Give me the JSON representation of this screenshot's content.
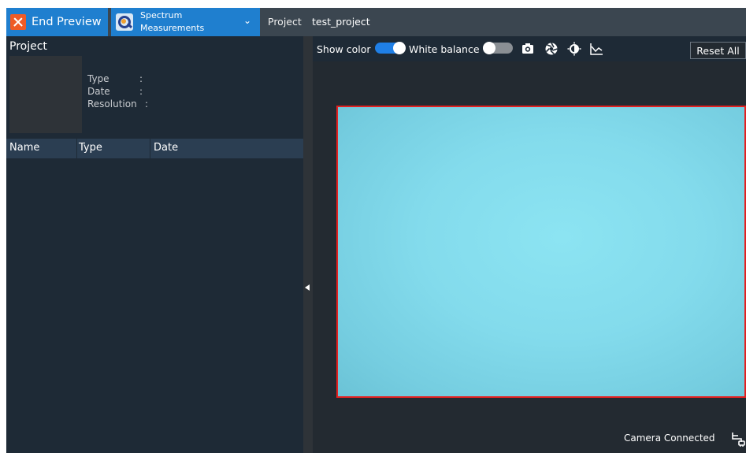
{
  "topbar": {
    "end_preview_label": "End Preview",
    "mode_line1": "Spectrum",
    "mode_line2": "Measurements",
    "project_label": "Project",
    "project_name": "test_project"
  },
  "left_panel": {
    "title": "Project",
    "meta": [
      {
        "label": "Type",
        "sep": ":",
        "value": ""
      },
      {
        "label": "Date",
        "sep": ":",
        "value": ""
      },
      {
        "label": "Resolution",
        "sep": ":",
        "value": ""
      }
    ],
    "columns": [
      "Name",
      "Type",
      "Date"
    ],
    "rows": []
  },
  "toolbar": {
    "show_color_label": "Show color",
    "show_color_on": true,
    "white_balance_label": "White balance",
    "white_balance_on": false,
    "icons": [
      "camera-icon",
      "aperture-icon",
      "contrast-icon",
      "chart-icon"
    ],
    "reset_label": "Reset All"
  },
  "status": {
    "text": "Camera Connected",
    "icon": "plug-icon"
  },
  "colors": {
    "accent": "#1f7fcf",
    "end_preview_x": "#ef5b26",
    "viewer_border": "#e32020",
    "toggle_on": "#1f7fe6",
    "toggle_off": "#8a8f94"
  }
}
